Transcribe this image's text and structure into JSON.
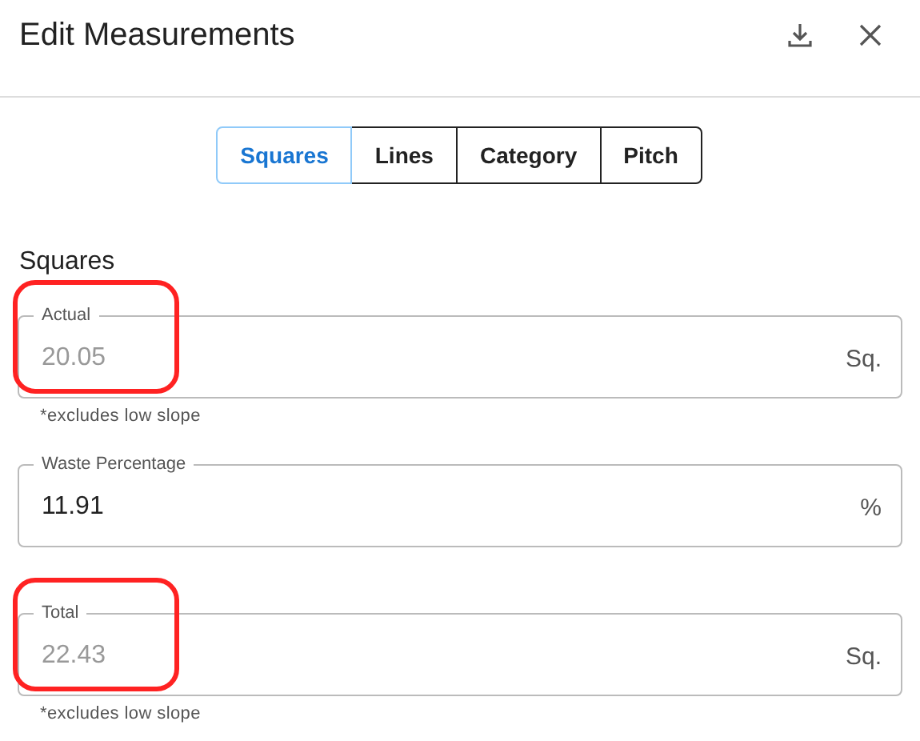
{
  "dialog": {
    "title": "Edit Measurements"
  },
  "tabs": [
    {
      "label": "Squares",
      "selected": true
    },
    {
      "label": "Lines",
      "selected": false
    },
    {
      "label": "Category",
      "selected": false
    },
    {
      "label": "Pitch",
      "selected": false
    }
  ],
  "section": {
    "title": "Squares"
  },
  "fields": [
    {
      "label": "Actual",
      "value": "20.05",
      "unit": "Sq.",
      "helper": "*excludes low slope",
      "disabled": true,
      "highlighted": true
    },
    {
      "label": "Waste Percentage",
      "value": "11.91",
      "unit": "%",
      "disabled": false,
      "highlighted": false
    },
    {
      "label": "Total",
      "value": "22.43",
      "unit": "Sq.",
      "helper": "*excludes low slope",
      "disabled": true,
      "highlighted": true
    }
  ]
}
